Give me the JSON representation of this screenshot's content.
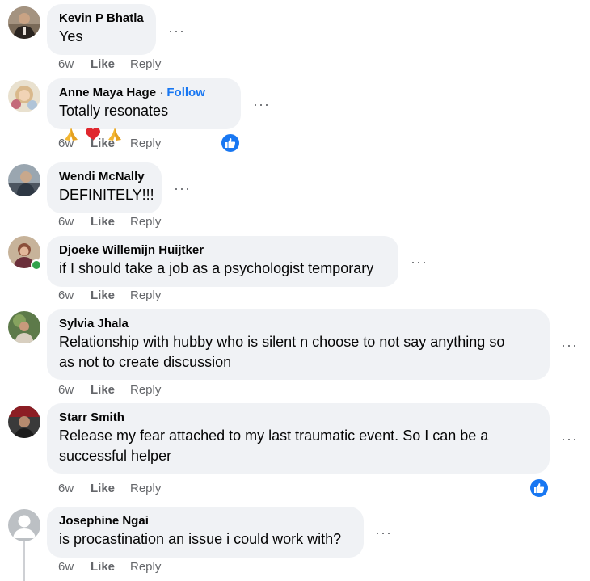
{
  "comments": [
    {
      "name": "Kevin P Bhatla",
      "text": "Yes",
      "time": "6w",
      "like": "Like",
      "reply": "Reply"
    },
    {
      "name": "Anne Maya Hage",
      "follow_sep": " · ",
      "follow": "Follow",
      "text": "Totally resonates",
      "emojis": [
        "folded-hands-emoji",
        "red-heart-emoji",
        "folded-hands-emoji"
      ],
      "time": "6w",
      "like": "Like",
      "reply": "Reply",
      "reaction": "like-reaction-icon"
    },
    {
      "name": "Wendi McNally",
      "text": "DEFINITELY!!!",
      "time": "6w",
      "like": "Like",
      "reply": "Reply"
    },
    {
      "name": "Djoeke Willemijn Huijtker",
      "text": "if I should take a job as a psychologist temporary",
      "time": "6w",
      "like": "Like",
      "reply": "Reply",
      "online": true
    },
    {
      "name": "Sylvia Jhala",
      "text_line1": "Relationship with hubby who is silent n choose to not say anything so",
      "text_line2": "as not to create discussion",
      "time": "6w",
      "like": "Like",
      "reply": "Reply"
    },
    {
      "name": "Starr Smith",
      "text_line1": "Release my fear attached to my last traumatic event. So I can be a",
      "text_line2": "successful helper",
      "time": "6w",
      "like": "Like",
      "reply": "Reply",
      "reaction": "like-reaction-icon"
    },
    {
      "name": "Josephine Ngai",
      "text": "is procastination an issue i could work with?",
      "time": "6w",
      "like": "Like",
      "reply": "Reply"
    }
  ],
  "more_glyph": "···",
  "colors": {
    "bubble": "#f0f2f5",
    "secondary_text": "#65676b",
    "link": "#1877f2",
    "online": "#31a24c"
  }
}
